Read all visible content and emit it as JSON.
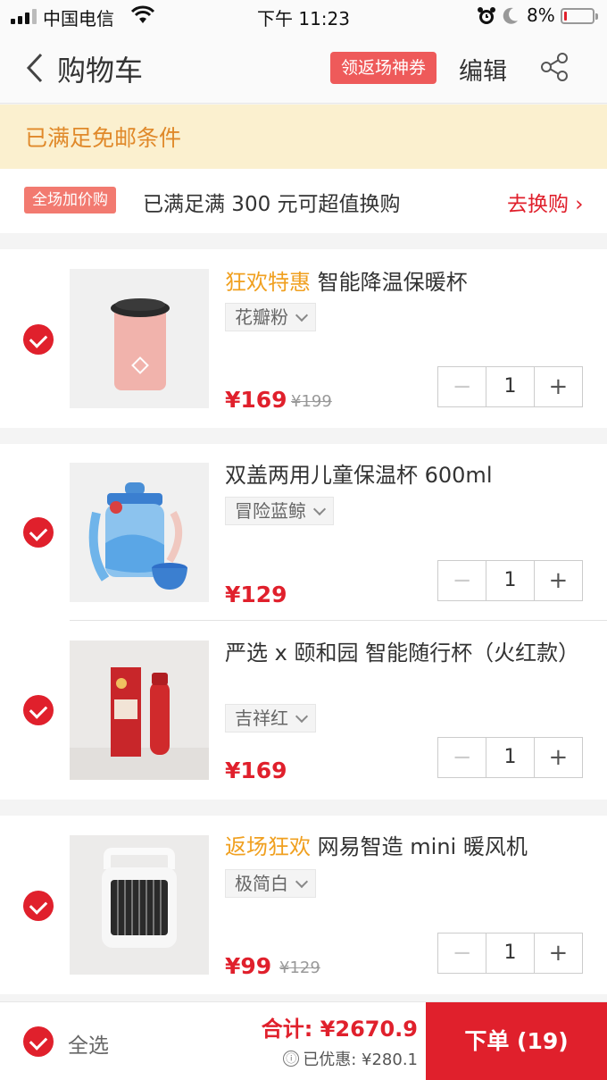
{
  "status_bar": {
    "carrier": "中国电信",
    "time": "下午 11:23",
    "battery_pct": "8%",
    "battery_level": 0.08,
    "icons": [
      "signal-icon",
      "wifi-icon",
      "alarm-icon",
      "moon-icon",
      "battery-icon"
    ]
  },
  "nav": {
    "title": "购物车",
    "coupon_label": "领返场神券",
    "edit_label": "编辑"
  },
  "free_shipping": "已满足免邮条件",
  "promo": {
    "tag": "全场加价购",
    "text": "已满足满 300 元可超值换购",
    "action": "去换购 ›"
  },
  "items": [
    {
      "badge": "狂欢特惠",
      "name": "智能降温保暖杯",
      "spec": "花瓣粉",
      "price": "¥169",
      "old_price": "¥199",
      "qty": "1",
      "checked": true
    },
    {
      "badge": "",
      "name": "双盖两用儿童保温杯 600ml",
      "spec": "冒险蓝鲸",
      "price": "¥129",
      "old_price": "",
      "qty": "1",
      "checked": true
    },
    {
      "badge": "",
      "name": "严选 x 颐和园 智能随行杯（火红款）",
      "spec": "吉祥红",
      "price": "¥169",
      "old_price": "",
      "qty": "1",
      "checked": true
    },
    {
      "badge": "返场狂欢",
      "name": "网易智造 mini 暖风机",
      "spec": "极简白",
      "price": "¥99",
      "old_price": "¥129",
      "qty": "1",
      "checked": true
    }
  ],
  "stepper": {
    "minus": "−",
    "plus": "+"
  },
  "footer": {
    "select_all": "全选",
    "total": "合计: ¥2670.9",
    "discount_icon": "ⓘ",
    "discount": "已优惠: ¥280.1",
    "order_button": "下单 (19)"
  },
  "colors": {
    "accent_red": "#e0202c",
    "badge_orange": "#f0a020",
    "banner_bg": "#fbf0cf",
    "banner_text": "#e0892a"
  }
}
